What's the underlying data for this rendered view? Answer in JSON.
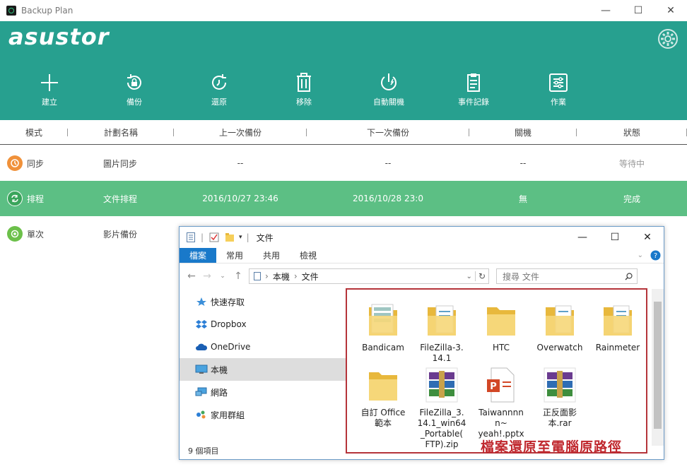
{
  "window": {
    "title": "Backup Plan",
    "minimize": "—",
    "maximize": "☐",
    "close": "✕"
  },
  "brand": {
    "logo": "asustor"
  },
  "toolbar": [
    {
      "label": "建立",
      "icon": "plus-icon"
    },
    {
      "label": "備份",
      "icon": "backup-icon"
    },
    {
      "label": "還原",
      "icon": "restore-icon"
    },
    {
      "label": "移除",
      "icon": "trash-icon"
    },
    {
      "label": "自動關機",
      "icon": "power-icon"
    },
    {
      "label": "事件記錄",
      "icon": "log-icon"
    },
    {
      "label": "作業",
      "icon": "tasks-icon"
    }
  ],
  "columns": [
    "模式",
    "計劃名稱",
    "上一次備份",
    "下一次備份",
    "關機",
    "狀態"
  ],
  "rows": [
    {
      "mode": "同步",
      "name": "圖片同步",
      "last": "--",
      "next": "--",
      "shutdown": "--",
      "status": "等待中",
      "color": "#f0913a"
    },
    {
      "mode": "排程",
      "name": "文件排程",
      "last": "2016/10/27 23:46",
      "next": "2016/10/28 23:0",
      "shutdown": "無",
      "status": "完成",
      "color": "#3aa55c"
    },
    {
      "mode": "單次",
      "name": "影片備份",
      "last": "",
      "next": "",
      "shutdown": "",
      "status": "",
      "color": "#6cc04a"
    }
  ],
  "explorer": {
    "title": "文件",
    "tabs": [
      "檔案",
      "常用",
      "共用",
      "檢視"
    ],
    "path": [
      "本機",
      "文件"
    ],
    "search_placeholder": "搜尋 文件",
    "nav": [
      "快速存取",
      "Dropbox",
      "OneDrive",
      "本機",
      "網路",
      "家用群組"
    ],
    "files": [
      {
        "name": "Bandicam",
        "type": "folder-doc"
      },
      {
        "name": "FileZilla-3.\n14.1",
        "type": "folder-doc"
      },
      {
        "name": "HTC",
        "type": "folder"
      },
      {
        "name": "Overwatch",
        "type": "folder-doc"
      },
      {
        "name": "Rainmeter",
        "type": "folder-doc"
      },
      {
        "name": "自訂 Office\n範本",
        "type": "folder"
      },
      {
        "name": "FileZilla_3.\n14.1_win64\n_Portable(\nFTP).zip",
        "type": "rar"
      },
      {
        "name": "Taiwannnn\nn~\nyeah!.pptx",
        "type": "pptx"
      },
      {
        "name": "正反面影\n本.rar",
        "type": "rar"
      }
    ],
    "status": "9 個項目"
  },
  "annotation": "檔案還原至電腦原路徑"
}
